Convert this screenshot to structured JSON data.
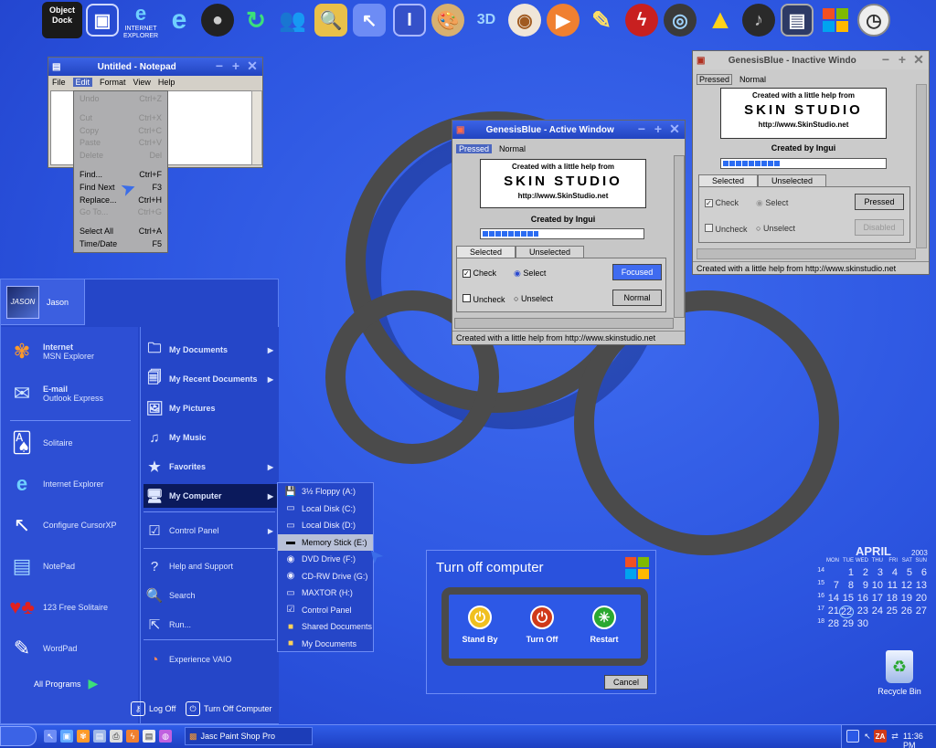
{
  "dock": {
    "label_line1": "Object",
    "label_line2": "Dock",
    "ie_label_line1": "INTERNET",
    "ie_label_line2": "EXPLORER",
    "icons": [
      "monitor-icon",
      "internet-explorer-icon",
      "internet-explorer-icon",
      "webcam-icon",
      "refresh-arrows-icon",
      "msn-users-icon",
      "folder-search-icon",
      "cursor-grid-icon",
      "book-icon",
      "paint-palette-icon",
      "3d-text-icon",
      "eye-icon",
      "media-player-icon",
      "pencil-icon",
      "flash-icon",
      "sound-device-icon",
      "warning-triangle-icon",
      "speaker-icon",
      "computer-icon",
      "windows-flag-icon",
      "clock-icon"
    ]
  },
  "notepad": {
    "title": "Untitled - Notepad",
    "menu": [
      "File",
      "Edit",
      "Format",
      "View",
      "Help"
    ],
    "active_menu": "Edit",
    "edit_menu": [
      {
        "label": "Undo",
        "shortcut": "Ctrl+Z",
        "enabled": false
      },
      {
        "label": "Cut",
        "shortcut": "Ctrl+X",
        "enabled": false
      },
      {
        "label": "Copy",
        "shortcut": "Ctrl+C",
        "enabled": false
      },
      {
        "label": "Paste",
        "shortcut": "Ctrl+V",
        "enabled": false
      },
      {
        "label": "Delete",
        "shortcut": "Del",
        "enabled": false
      },
      {
        "label": "Find...",
        "shortcut": "Ctrl+F",
        "enabled": true
      },
      {
        "label": "Find Next",
        "shortcut": "F3",
        "enabled": true
      },
      {
        "label": "Replace...",
        "shortcut": "Ctrl+H",
        "enabled": true
      },
      {
        "label": "Go To...",
        "shortcut": "Ctrl+G",
        "enabled": false
      },
      {
        "label": "Select All",
        "shortcut": "Ctrl+A",
        "enabled": true
      },
      {
        "label": "Time/Date",
        "shortcut": "F5",
        "enabled": true
      }
    ]
  },
  "active_window": {
    "title": "GenesisBlue - Active Window",
    "menu": [
      "Pressed",
      "Normal"
    ],
    "logo_top": "Created with a little help from",
    "logo_name": "SKIN STUDIO",
    "logo_url": "http://www.SkinStudio.net",
    "credit": "Created by Ingui",
    "progress": 0.35,
    "tabs": [
      "Selected",
      "Unselected"
    ],
    "check_label": "Check",
    "select_label": "Select",
    "uncheck_label": "Uncheck",
    "unselect_label": "Unselect",
    "btn_focused": "Focused",
    "btn_normal": "Normal",
    "status": "Created with a little help from http://www.skinstudio.net"
  },
  "inactive_window": {
    "title": "GenesisBlue - Inactive Windo",
    "menu": [
      "Pressed",
      "Normal"
    ],
    "logo_top": "Created with a little help from",
    "logo_name": "SKIN STUDIO",
    "logo_url": "http://www.SkinStudio.net",
    "credit": "Created by Ingui",
    "progress": 0.35,
    "tabs": [
      "Selected",
      "Unselected"
    ],
    "check_label": "Check",
    "select_label": "Select",
    "uncheck_label": "Uncheck",
    "unselect_label": "Unselect",
    "btn_pressed": "Pressed",
    "btn_disabled": "Disabled",
    "status": "Created with a little help from http://www.skinstudio.net"
  },
  "start_menu": {
    "user": "Jason",
    "left_items": [
      {
        "title": "Internet",
        "subtitle": "MSN Explorer",
        "icon": "msn-butterfly-icon"
      },
      {
        "title": "E-mail",
        "subtitle": "Outlook Express",
        "icon": "email-icon"
      },
      {
        "title": "Solitaire",
        "subtitle": "",
        "icon": "cards-icon"
      },
      {
        "title": "Internet Explorer",
        "subtitle": "",
        "icon": "internet-explorer-icon"
      },
      {
        "title": "Configure CursorXP",
        "subtitle": "",
        "icon": "cursor-icon"
      },
      {
        "title": "NotePad",
        "subtitle": "",
        "icon": "notepad-icon"
      },
      {
        "title": "123 Free Solitaire",
        "subtitle": "",
        "icon": "card-suits-icon"
      },
      {
        "title": "WordPad",
        "subtitle": "",
        "icon": "wordpad-icon"
      }
    ],
    "all_programs": "All Programs",
    "right_items": [
      {
        "label": "My Documents",
        "arrow": true,
        "icon": "folder-icon"
      },
      {
        "label": "My Recent Documents",
        "arrow": true,
        "icon": "recent-docs-icon"
      },
      {
        "label": "My Pictures",
        "arrow": false,
        "icon": "pictures-icon"
      },
      {
        "label": "My Music",
        "arrow": false,
        "icon": "music-icon"
      },
      {
        "label": "Favorites",
        "arrow": true,
        "icon": "star-icon"
      },
      {
        "label": "My Computer",
        "arrow": true,
        "icon": "computer-icon"
      },
      {
        "label": "Control Panel",
        "arrow": true,
        "icon": "control-panel-icon"
      },
      {
        "label": "Help and Support",
        "arrow": false,
        "icon": "help-icon"
      },
      {
        "label": "Search",
        "arrow": false,
        "icon": "search-icon"
      },
      {
        "label": "Run...",
        "arrow": false,
        "icon": "run-icon"
      },
      {
        "label": "Experience VAIO",
        "arrow": false,
        "icon": "vaio-icon"
      }
    ],
    "log_off": "Log Off",
    "turn_off": "Turn Off Computer"
  },
  "my_computer_submenu": [
    {
      "label": "3½ Floppy (A:)",
      "icon": "floppy-icon"
    },
    {
      "label": "Local Disk (C:)",
      "icon": "disk-icon"
    },
    {
      "label": "Local Disk (D:)",
      "icon": "disk-icon"
    },
    {
      "label": "Memory Stick (E:)",
      "icon": "memory-stick-icon"
    },
    {
      "label": "DVD Drive (F:)",
      "icon": "dvd-icon"
    },
    {
      "label": "CD-RW Drive (G:)",
      "icon": "cd-icon"
    },
    {
      "label": "MAXTOR (H:)",
      "icon": "disk-icon"
    },
    {
      "label": "Control Panel",
      "icon": "control-panel-icon"
    },
    {
      "label": "Shared Documents",
      "icon": "folder-icon"
    },
    {
      "label": "My Documents",
      "icon": "folder-icon"
    }
  ],
  "turn_off_dialog": {
    "title": "Turn off computer",
    "stand_by": "Stand By",
    "turn_off": "Turn Off",
    "restart": "Restart",
    "cancel": "Cancel"
  },
  "calendar": {
    "month": "APRIL",
    "year": "2003",
    "weekdays": [
      "MON",
      "TUE",
      "WED",
      "THU",
      "FRI",
      "SAT",
      "SUN"
    ],
    "week_numbers": [
      "14",
      "15",
      "16",
      "17",
      "18"
    ],
    "weeks": [
      [
        "",
        "1",
        "2",
        "3",
        "4",
        "5",
        "6"
      ],
      [
        "7",
        "8",
        "9",
        "10",
        "11",
        "12",
        "13"
      ],
      [
        "14",
        "15",
        "16",
        "17",
        "18",
        "19",
        "20"
      ],
      [
        "21",
        "22",
        "23",
        "24",
        "25",
        "26",
        "27"
      ],
      [
        "28",
        "29",
        "30",
        "",
        "",
        "",
        ""
      ]
    ],
    "today": "22"
  },
  "desktop": {
    "recycle_bin": "Recycle Bin"
  },
  "taskbar": {
    "task": "Jasc Paint Shop Pro",
    "clock": "11:36 PM"
  },
  "colors": {
    "desktop": "#2c55e0",
    "ring": "#4b4b4b",
    "start_menu": "#2546c8",
    "highlight": "#4a66c0"
  }
}
